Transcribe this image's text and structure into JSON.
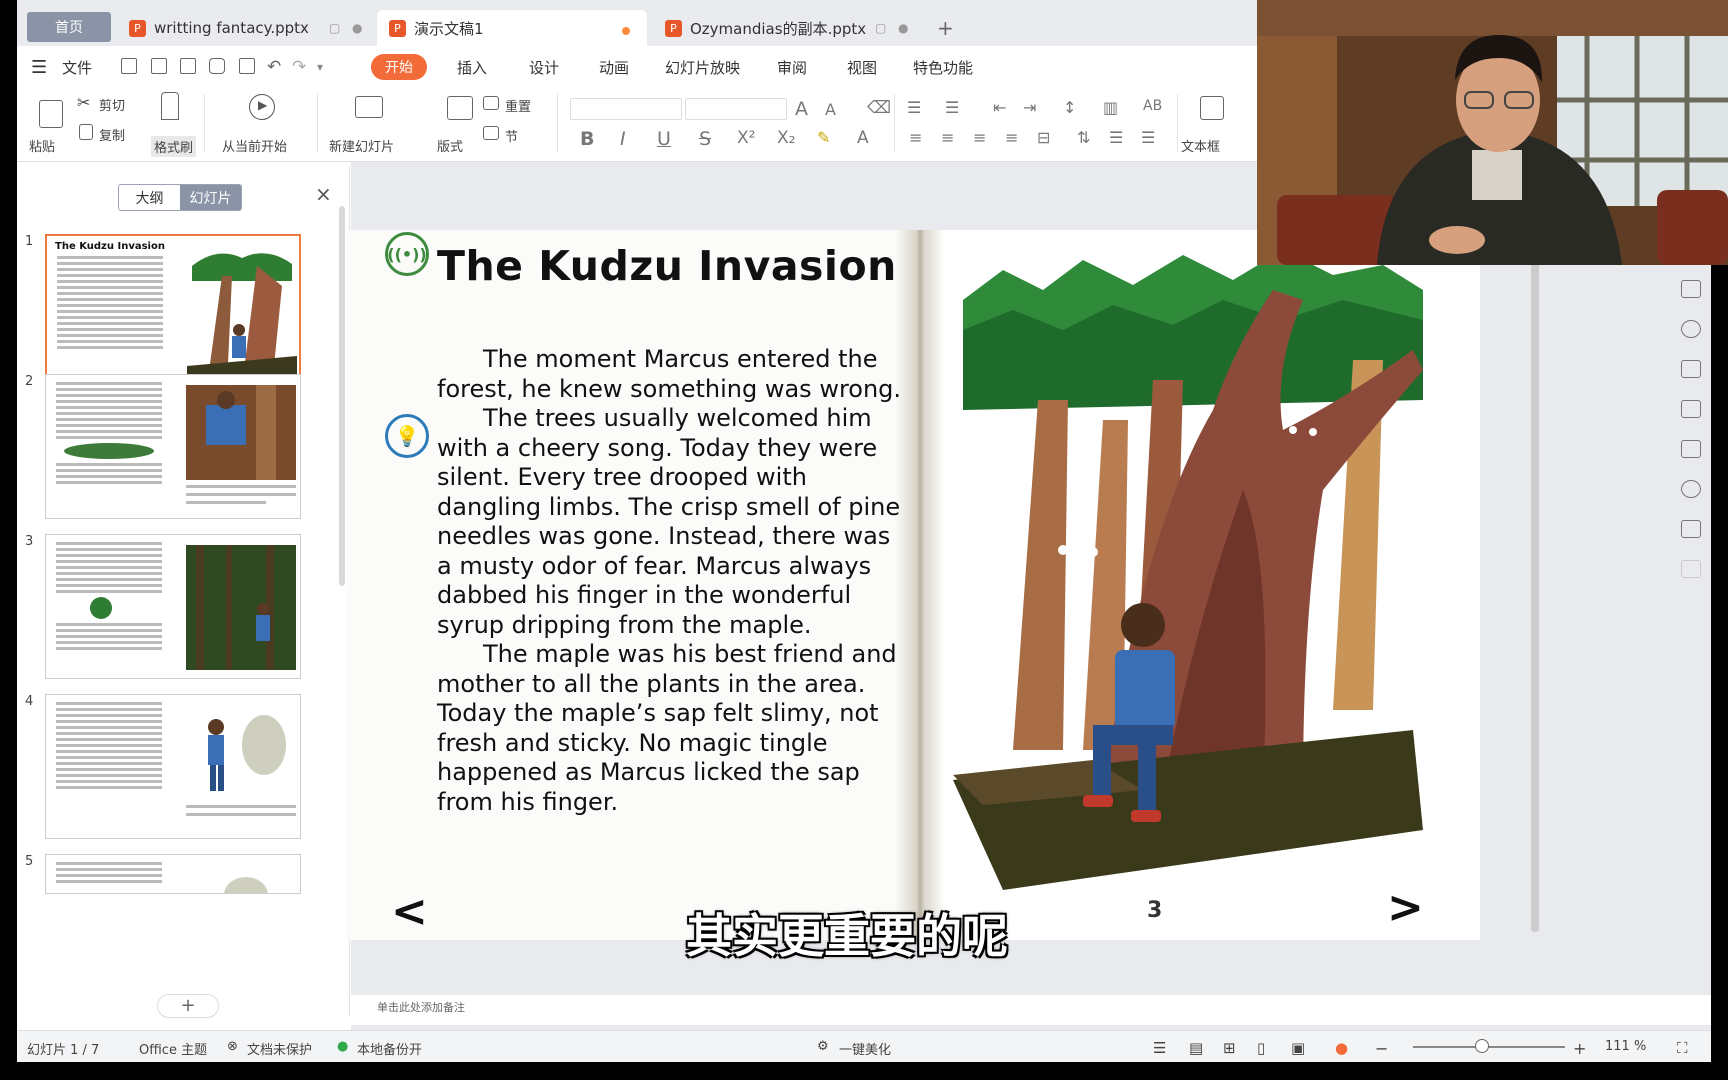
{
  "tabs": {
    "home": "首页",
    "items": [
      {
        "label": "writting fantacy.pptx"
      },
      {
        "label": "演示文稿1"
      },
      {
        "label": "Ozymandias的副本.pptx"
      }
    ],
    "new_tab": "+"
  },
  "menu": {
    "file": "文件",
    "items": [
      "开始",
      "插入",
      "设计",
      "动画",
      "幻灯片放映",
      "审阅",
      "视图",
      "特色功能"
    ]
  },
  "ribbon": {
    "paste": "粘贴",
    "cut": "剪切",
    "copy": "复制",
    "format_painter": "格式刷",
    "play_from_current": "从当前开始",
    "new_slide": "新建幻灯片",
    "layout": "版式",
    "reset": "重置",
    "section": "节",
    "textbox": "文本框",
    "format_glyphs": [
      "B",
      "I",
      "U",
      "S",
      "X²",
      "X₂"
    ]
  },
  "left_panel": {
    "view_outline": "大纲",
    "view_slides": "幻灯片",
    "close": "×",
    "add": "+",
    "slides": [
      {
        "num": "1",
        "title": "The Kudzu Invasion"
      },
      {
        "num": "2"
      },
      {
        "num": "3"
      },
      {
        "num": "4"
      },
      {
        "num": "5"
      }
    ]
  },
  "slide": {
    "title": "The Kudzu Invasion",
    "paragraphs": [
      "The moment Marcus entered the forest, he knew something was wrong.",
      "The trees usually welcomed him with a cheery song. Today they were silent. Every tree drooped with dangling limbs. The crisp smell of pine needles was gone. Instead, there was a musty odor of fear. Marcus always dabbed his finger in the wonderful syrup dripping from the maple.",
      "The maple was his best friend and mother to all the plants in the area. Today the maple’s sap felt slimy, not fresh and sticky. No magic tingle happened as Marcus licked the sap from his finger."
    ],
    "prev": "<",
    "next": ">",
    "page_number": "3"
  },
  "notes_placeholder": "单击此处添加备注",
  "status": {
    "slide_count": "幻灯片 1 / 7",
    "theme": "Office 主题",
    "protect": "文档未保护",
    "backup": "本地备份开",
    "beautify": "一键美化",
    "zoom": "111 %"
  },
  "subtitle": "其实更重要的呢",
  "colors": {
    "accent": "#f26b39",
    "tab_home": "#8a94a6",
    "selected_border": "#f07a3d"
  }
}
